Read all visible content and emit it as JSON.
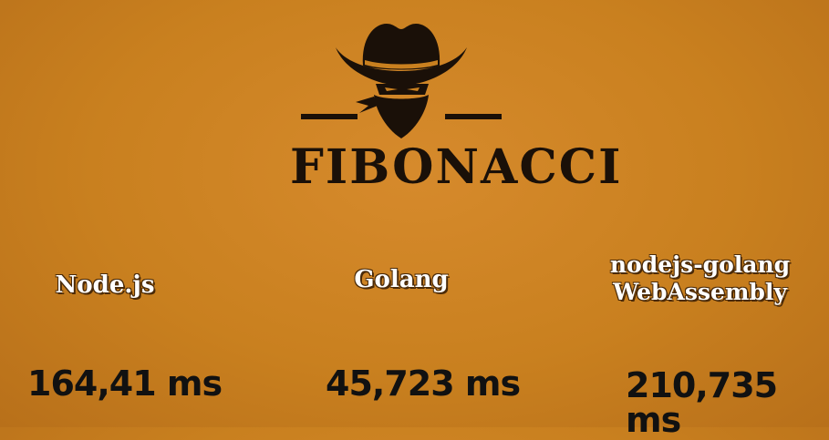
{
  "logo": {
    "title": "FIBONACCI",
    "icon": "cowboy-bandit-icon"
  },
  "results": [
    {
      "label": "Node.js",
      "value": "164,41 ms"
    },
    {
      "label": "Golang",
      "value": "45,723 ms"
    },
    {
      "label_line1": "nodejs-golang",
      "label_line2": "WebAssembly",
      "value": "210,735 ms"
    }
  ],
  "colors": {
    "background": "#c9801f",
    "ink": "#1a1008",
    "label_text": "#ffffff"
  }
}
